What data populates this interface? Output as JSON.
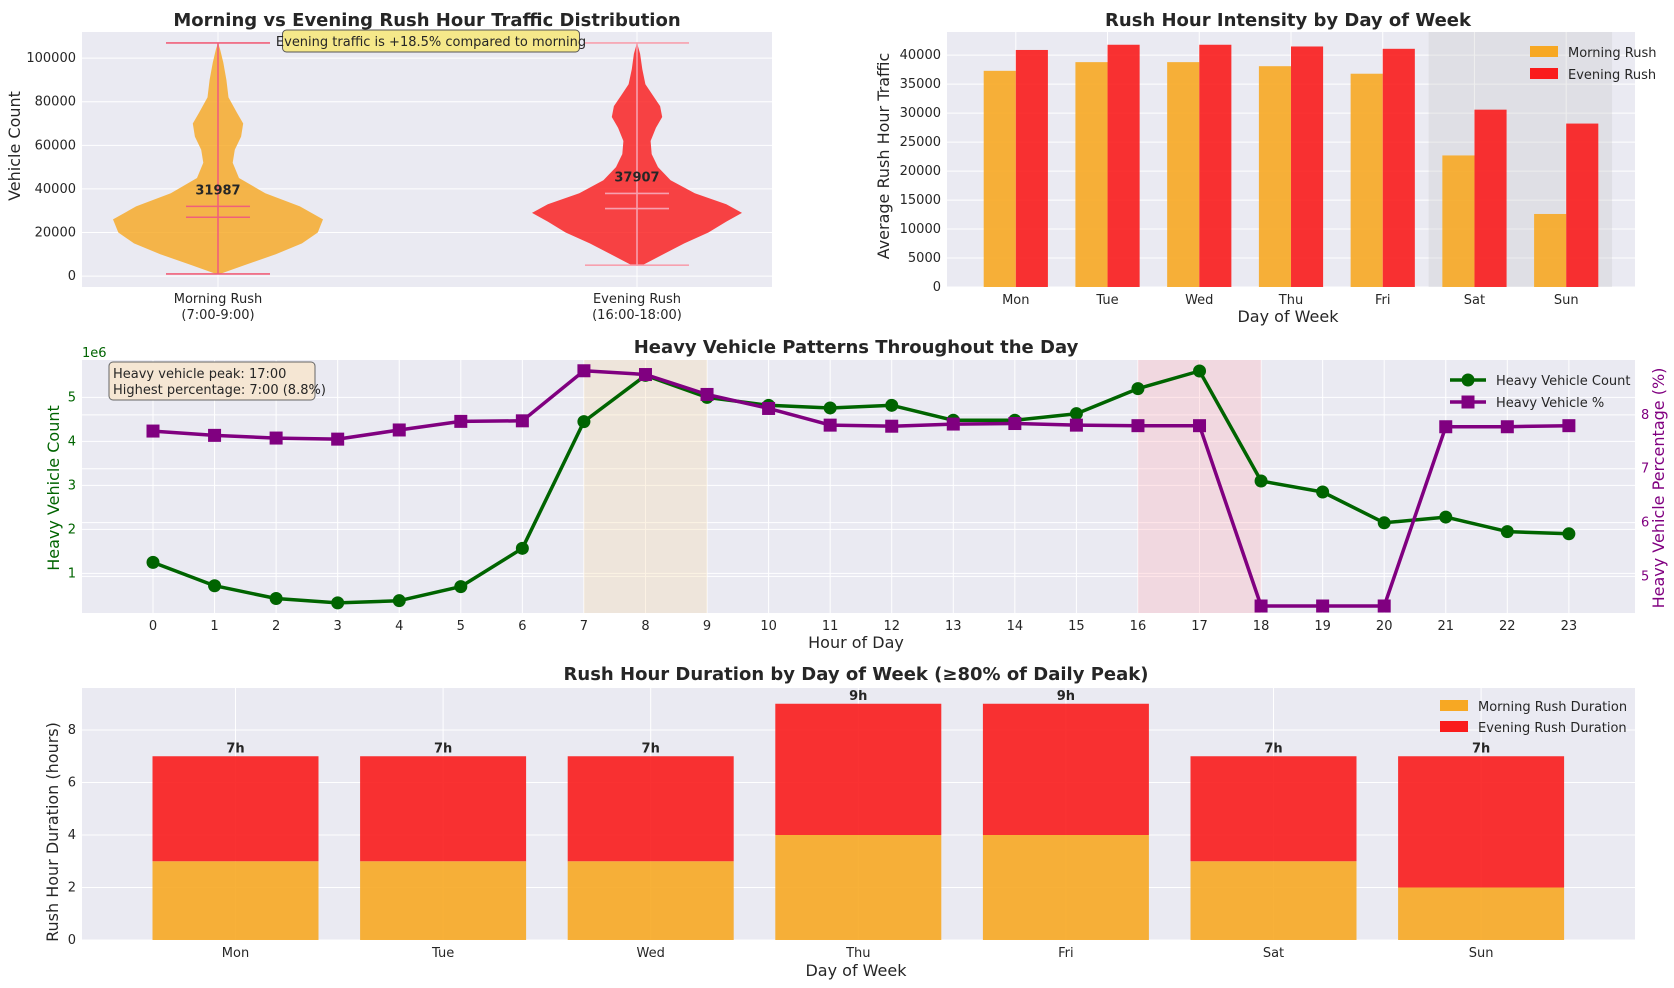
{
  "colors": {
    "morning": "#F7A823",
    "evening": "#FA1C1C",
    "heavy_count": "#006400",
    "heavy_pct": "#800080",
    "violin_lines": "#F0607A",
    "annotation_bg": "#F5E88A"
  },
  "chart_data": [
    {
      "type": "violin",
      "title": "Morning vs Evening Rush Hour Traffic Distribution",
      "ylabel": "Vehicle Count",
      "ylim": [
        -5000,
        112000
      ],
      "yticks": [
        0,
        20000,
        40000,
        60000,
        80000,
        100000
      ],
      "categories": [
        "Morning Rush\n(7:00-9:00)",
        "Evening Rush\n(16:00-18:00)"
      ],
      "category_lines": [
        [
          "Morning Rush",
          "(7:00-9:00)"
        ],
        [
          "Evening Rush",
          "(16:00-18:00)"
        ]
      ],
      "series": [
        {
          "name": "Morning Rush",
          "min": 1000,
          "max": 107000,
          "median": 27000,
          "mean": 31987,
          "mean_label": "31987",
          "density_profile": [
            [
              1000,
              0.02
            ],
            [
              5000,
              0.25
            ],
            [
              10000,
              0.55
            ],
            [
              15000,
              0.8
            ],
            [
              20000,
              0.95
            ],
            [
              26000,
              1.0
            ],
            [
              32000,
              0.78
            ],
            [
              38000,
              0.45
            ],
            [
              45000,
              0.2
            ],
            [
              52000,
              0.14
            ],
            [
              58000,
              0.16
            ],
            [
              64000,
              0.22
            ],
            [
              70000,
              0.24
            ],
            [
              75000,
              0.18
            ],
            [
              82000,
              0.1
            ],
            [
              90000,
              0.08
            ],
            [
              98000,
              0.05
            ],
            [
              104000,
              0.02
            ],
            [
              107000,
              0.0
            ]
          ]
        },
        {
          "name": "Evening Rush",
          "min": 5000,
          "max": 107000,
          "median": 31000,
          "mean": 37907,
          "mean_label": "37907",
          "density_profile": [
            [
              5000,
              0.05
            ],
            [
              10000,
              0.25
            ],
            [
              15000,
              0.45
            ],
            [
              20000,
              0.68
            ],
            [
              25000,
              0.85
            ],
            [
              29000,
              1.0
            ],
            [
              33000,
              0.85
            ],
            [
              38000,
              0.55
            ],
            [
              44000,
              0.32
            ],
            [
              50000,
              0.2
            ],
            [
              56000,
              0.14
            ],
            [
              62000,
              0.13
            ],
            [
              68000,
              0.18
            ],
            [
              73000,
              0.24
            ],
            [
              78000,
              0.22
            ],
            [
              83000,
              0.15
            ],
            [
              88000,
              0.08
            ],
            [
              95000,
              0.05
            ],
            [
              102000,
              0.03
            ],
            [
              107000,
              0.0
            ]
          ]
        }
      ],
      "annotation": "Evening traffic is +18.5% compared to morning"
    },
    {
      "type": "bar",
      "title": "Rush Hour Intensity by Day of Week",
      "xlabel": "Day of Week",
      "ylabel": "Average Rush Hour Traffic",
      "ylim": [
        0,
        44000
      ],
      "yticks": [
        0,
        5000,
        10000,
        15000,
        20000,
        25000,
        30000,
        35000,
        40000
      ],
      "categories": [
        "Mon",
        "Tue",
        "Wed",
        "Thu",
        "Fri",
        "Sat",
        "Sun"
      ],
      "series": [
        {
          "name": "Morning Rush",
          "values": [
            37300,
            38800,
            38800,
            38100,
            36800,
            22700,
            12600
          ]
        },
        {
          "name": "Evening Rush",
          "values": [
            40900,
            41800,
            41800,
            41500,
            41100,
            30600,
            28200
          ]
        }
      ],
      "legend": "top-right",
      "weekend_shaded": [
        "Sat",
        "Sun"
      ]
    },
    {
      "type": "line",
      "title": "Heavy Vehicle Patterns Throughout the Day",
      "xlabel": "Hour of Day",
      "ylabel": "Heavy Vehicle Count",
      "ylabel_right": "Heavy Vehicle Percentage (%)",
      "y_offset_label": "1e6",
      "x": [
        0,
        1,
        2,
        3,
        4,
        5,
        6,
        7,
        8,
        9,
        10,
        11,
        12,
        13,
        14,
        15,
        16,
        17,
        18,
        19,
        20,
        21,
        22,
        23
      ],
      "ylim": [
        0.1,
        5.85
      ],
      "yticks": [
        1,
        2,
        3,
        4,
        5
      ],
      "ylim_right": [
        4.32,
        9.02
      ],
      "yticks_right": [
        5,
        6,
        7,
        8
      ],
      "series": [
        {
          "name": "Heavy Vehicle Count",
          "axis": "left",
          "marker": "circle",
          "values": [
            1.25,
            0.72,
            0.43,
            0.33,
            0.38,
            0.7,
            1.57,
            4.45,
            5.5,
            5.0,
            4.82,
            4.76,
            4.82,
            4.48,
            4.48,
            4.63,
            5.2,
            5.6,
            3.1,
            2.85,
            2.15,
            2.28,
            1.95,
            1.9
          ]
        },
        {
          "name": "Heavy Vehicle %",
          "axis": "right",
          "marker": "square",
          "values": [
            7.7,
            7.62,
            7.57,
            7.55,
            7.72,
            7.88,
            7.89,
            8.82,
            8.75,
            8.38,
            8.12,
            7.81,
            7.79,
            7.83,
            7.84,
            7.81,
            7.8,
            7.8,
            4.45,
            4.45,
            4.45,
            7.78,
            7.78,
            7.8
          ]
        }
      ],
      "shaded_ranges": [
        [
          7,
          9
        ],
        [
          16,
          18
        ]
      ],
      "legend": "top-right",
      "annotation_lines": [
        "Heavy vehicle peak: 17:00",
        "Highest percentage: 7:00 (8.8%)"
      ]
    },
    {
      "type": "bar",
      "stacked": true,
      "title": "Rush Hour Duration by Day of Week (≥80% of Daily Peak)",
      "xlabel": "Day of Week",
      "ylabel": "Rush Hour Duration (hours)",
      "ylim": [
        0,
        9.6
      ],
      "yticks": [
        0,
        2,
        4,
        6,
        8
      ],
      "categories": [
        "Mon",
        "Tue",
        "Wed",
        "Thu",
        "Fri",
        "Sat",
        "Sun"
      ],
      "series": [
        {
          "name": "Morning Rush Duration",
          "values": [
            3,
            3,
            3,
            4,
            4,
            3,
            2
          ]
        },
        {
          "name": "Evening Rush Duration",
          "values": [
            4,
            4,
            4,
            5,
            5,
            4,
            5
          ]
        }
      ],
      "totals_labels": [
        "7h",
        "7h",
        "7h",
        "9h",
        "9h",
        "7h",
        "7h"
      ],
      "legend": "top-right"
    }
  ]
}
